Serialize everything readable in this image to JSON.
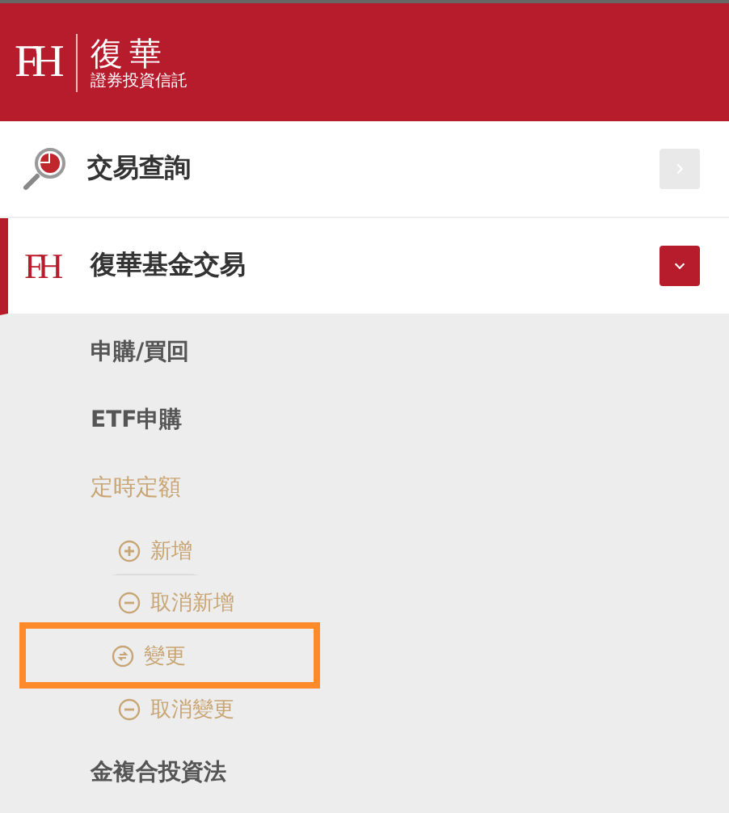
{
  "header": {
    "logo_mark": "FH",
    "brand": "復華",
    "brand_sub": "證券投資信託"
  },
  "menu": [
    {
      "label": "交易查詢",
      "kind": "search",
      "expanded": false
    },
    {
      "label": "復華基金交易",
      "kind": "brand",
      "icon_text": "FH",
      "expanded": true,
      "children": [
        {
          "label": "申購/買回",
          "selected": false
        },
        {
          "label": "ETF申購",
          "selected": false
        },
        {
          "label": "定時定額",
          "selected": true,
          "children": [
            {
              "label": "新增",
              "kind": "add",
              "highlighted": false
            },
            {
              "label": "取消新增",
              "kind": "remove",
              "highlighted": false
            },
            {
              "label": "變更",
              "kind": "change",
              "highlighted": true
            },
            {
              "label": "取消變更",
              "kind": "remove",
              "highlighted": false
            }
          ]
        },
        {
          "label": "金複合投資法",
          "selected": false
        }
      ]
    }
  ]
}
